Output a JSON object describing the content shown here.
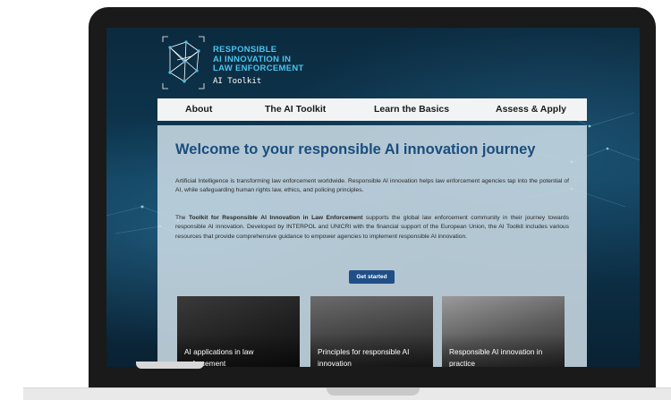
{
  "logo": {
    "lines": [
      "RESPONSIBLE",
      "AI INNOVATION IN",
      "LAW ENFORCEMENT"
    ],
    "subtitle": "AI Toolkit",
    "icon": "network-polygon-icon"
  },
  "nav": {
    "items": [
      "About",
      "The AI Toolkit",
      "Learn the Basics",
      "Assess & Apply"
    ]
  },
  "welcome": {
    "title": "Welcome to your responsible AI innovation journey",
    "paragraph_1": "Artificial Intelligence is transforming law enforcement worldwide. Responsible AI innovation helps law enforcement agencies tap into the potential of AI, while safeguarding human rights law, ethics, and policing principles.",
    "paragraph_2_bold": "Toolkit for Responsible AI Innovation in Law Enforcement",
    "paragraph_2_pre": "The ",
    "paragraph_2_rest": " supports the global law enforcement community in their journey towards responsible AI innovation. Developed by INTERPOL and UNICRI with the financial support of the European Union, the AI Toolkit includes various resources that provide comprehensive guidance to empower agencies to implement responsible AI innovation.",
    "cta_label": "Get started"
  },
  "tiles": [
    {
      "caption": "AI applications in law enforcement"
    },
    {
      "caption": "Principles for responsible AI innovation"
    },
    {
      "caption": "Responsible AI innovation in practice"
    }
  ],
  "colors": {
    "accent": "#1f4f86",
    "title": "#1b4d7d",
    "logo_text": "#4cc3f0",
    "background": "#0e3a54"
  }
}
